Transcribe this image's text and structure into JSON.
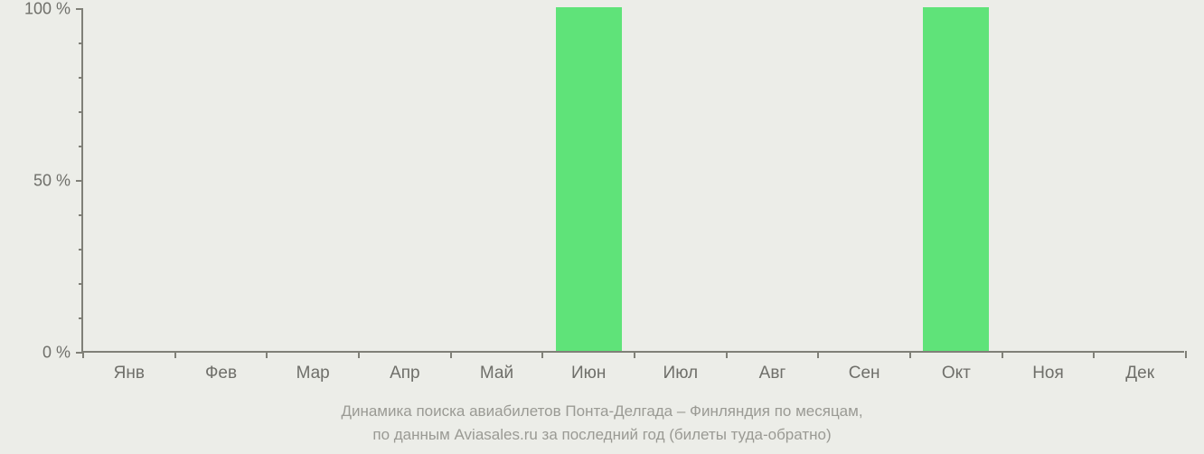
{
  "chart_data": {
    "type": "bar",
    "categories": [
      "Янв",
      "Фев",
      "Мар",
      "Апр",
      "Май",
      "Июн",
      "Июл",
      "Авг",
      "Сен",
      "Окт",
      "Ноя",
      "Дек"
    ],
    "values": [
      0,
      0,
      0,
      0,
      0,
      100,
      0,
      0,
      0,
      100,
      0,
      0
    ],
    "ylabel": "",
    "xlabel": "",
    "ylim": [
      0,
      100
    ],
    "y_ticks_major": [
      0,
      50,
      100
    ],
    "y_tick_labels": [
      "0 %",
      "50 %",
      "100 %"
    ],
    "y_minor_count_between": 4,
    "bar_color": "#5fe379"
  },
  "caption": {
    "line1": "Динамика поиска авиабилетов Понта-Делгада – Финляндия по месяцам,",
    "line2": "по данным Aviasales.ru за последний год (билеты туда-обратно)"
  }
}
